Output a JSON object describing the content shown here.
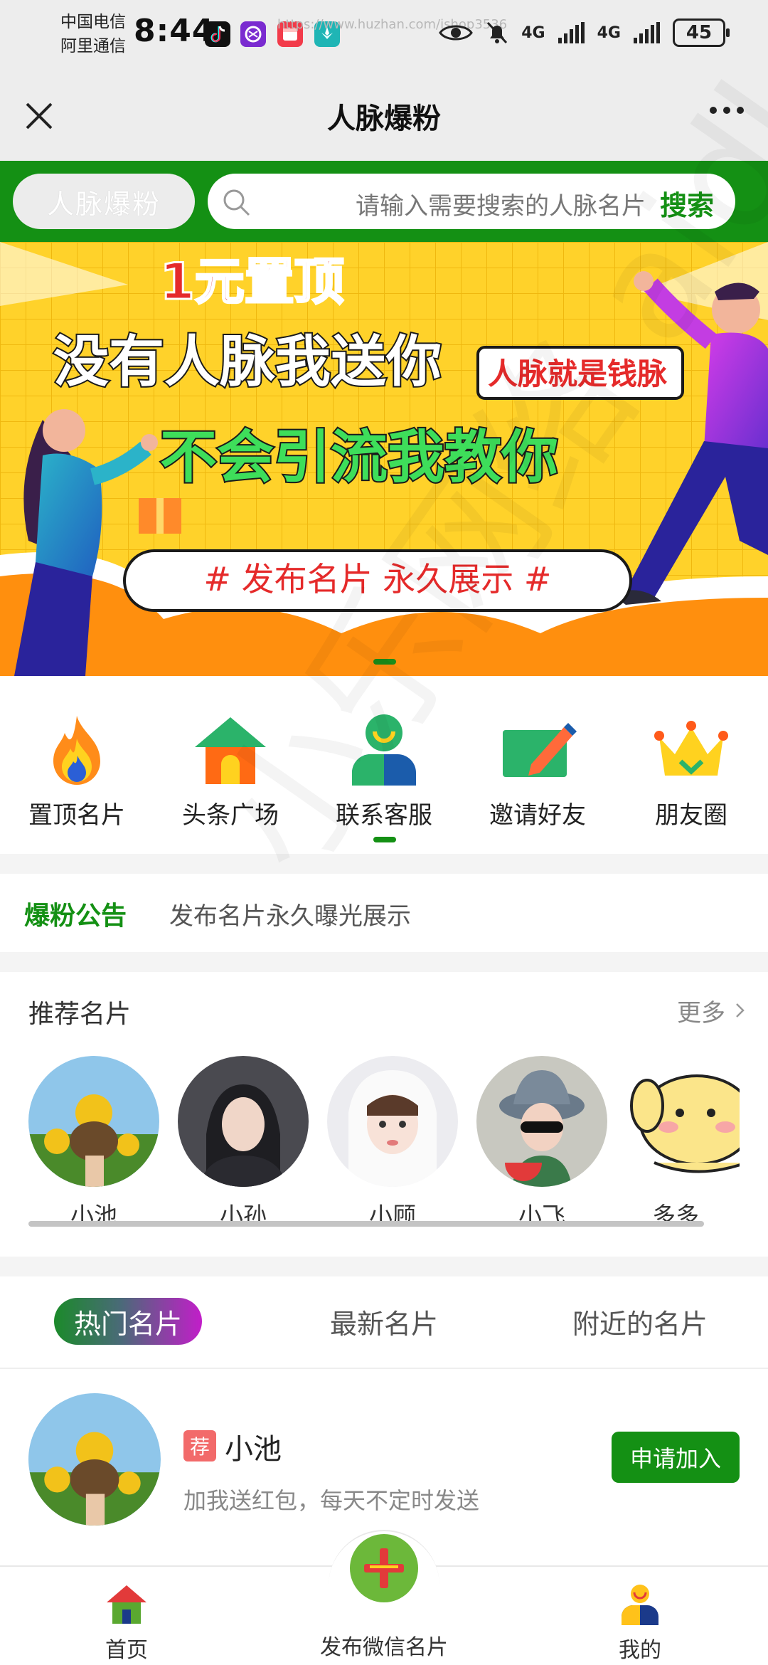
{
  "status_bar": {
    "carrier_1": "中国电信",
    "carrier_2": "阿里通信",
    "time": "8:44",
    "url_watermark": "https://www.huzhan.com/ishop3536",
    "network_1": "4G",
    "network_2": "4G",
    "battery": "45"
  },
  "nav": {
    "title": "人脉爆粉"
  },
  "search": {
    "brand": "人脉爆粉",
    "placeholder": "请输入需要搜索的人脉名片",
    "button": "搜索"
  },
  "banner": {
    "tag": "1元置顶",
    "line1": "没有人脉我送你",
    "badge": "人脉就是钱脉",
    "line2": "不会引流我教你",
    "slogan": "# 发布名片   永久展示 #"
  },
  "quick_menu": [
    {
      "label": "置顶名片",
      "icon": "fire-icon"
    },
    {
      "label": "头条广场",
      "icon": "house-icon"
    },
    {
      "label": "联系客服",
      "icon": "service-icon"
    },
    {
      "label": "邀请好友",
      "icon": "invite-icon"
    },
    {
      "label": "朋友圈",
      "icon": "crown-icon"
    }
  ],
  "notice": {
    "tag": "爆粉公告",
    "text": "发布名片永久曝光展示"
  },
  "recommend": {
    "title": "推荐名片",
    "more": "更多",
    "items": [
      {
        "name": "小池"
      },
      {
        "name": "小孙"
      },
      {
        "name": "小顾"
      },
      {
        "name": "小飞"
      },
      {
        "name": "多多"
      }
    ]
  },
  "tabs": [
    {
      "label": "热门名片",
      "active": true
    },
    {
      "label": "最新名片",
      "active": false
    },
    {
      "label": "附近的名片",
      "active": false
    }
  ],
  "card": {
    "badge": "荐",
    "name": "小池",
    "desc": "加我送红包，每天不定时发送",
    "button": "申请加入"
  },
  "bottom_nav": {
    "home": "首页",
    "publish": "发布微信名片",
    "mine": "我的"
  },
  "watermark": "小乐网络 aidle190",
  "colors": {
    "brand_green": "#149014",
    "tag_red": "#f26a6a",
    "banner_yellow": "#ffcf22"
  }
}
